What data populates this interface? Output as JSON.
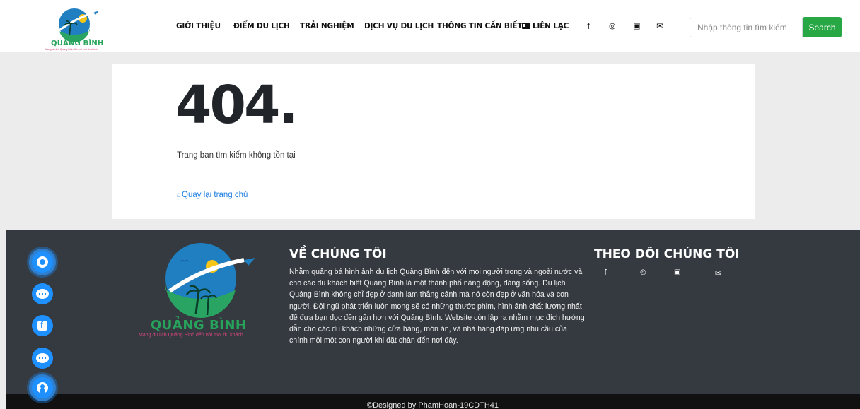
{
  "header": {
    "logo_text": "QUẢNG BÌNH",
    "logo_tagline": "Mang du lịch Quảng Bình đến với mọi du khách",
    "nav": [
      {
        "label": "GIỚI THIỆU"
      },
      {
        "label": "ĐIỂM DU LỊCH"
      },
      {
        "label": "TRẢI NGHIỆM"
      },
      {
        "label": "DỊCH VỤ DU LỊCH"
      },
      {
        "label": "THÔNG TIN CẦN BIẾT"
      },
      {
        "label": "LIÊN LẠC",
        "icon": "id-card-icon"
      }
    ],
    "social_icons": [
      "facebook-icon",
      "instagram-icon",
      "youtube-icon",
      "envelope-icon"
    ],
    "search": {
      "placeholder": "Nhập thông tin tìm kiếm",
      "button_label": "Search"
    }
  },
  "error": {
    "code": "404.",
    "message": "Trang bạn tìm kiếm không tồn tại",
    "home_link": "Quay lại trang chủ",
    "home_icon": "home-icon"
  },
  "footer": {
    "logo_text": "QUẢNG BÌNH",
    "logo_tagline": "Mang du lịch Quảng Bình đến với mọi du khách",
    "about_title": "VỀ CHÚNG TÔI",
    "about_text": "Nhằm quảng bá hình ảnh du lịch Quảng Bình đến với mọi người trong và ngoài nước và cho các du khách biết Quảng Bình là một thành phố năng động, đáng sống. Du lịch Quảng Bình không chỉ đẹp ở danh lam thắng cảnh mà nó còn đẹp ở văn hóa và con người. Đội ngũ phát triển luôn mong sẽ có những thước phim, hình ảnh chất lượng nhất để đưa bạn đọc đến gần hơn với Quảng Bình. Website còn lập ra nhằm mục đích hướng dẫn cho các du khách những cửa hàng, món ăn, và nhà hàng đáp ứng nhu cầu của chính mỗi một con người khi đặt chân đến nơi đây.",
    "follow_title": "THEO DÕI CHÚNG TÔI",
    "social_icons": [
      "facebook-icon",
      "instagram-icon",
      "youtube-icon",
      "envelope-icon"
    ],
    "copyright": "©Designed by PhamHoan-19CDTH41"
  },
  "floating_buttons": [
    "whatsapp-icon",
    "wechat-icon",
    "facebook-messenger-icon",
    "chat-icon",
    "user-icon"
  ],
  "colors": {
    "accent_green": "#28a745",
    "link_blue": "#1e7fe3",
    "footer_bg": "#343a40",
    "fab_blue": "#1e90ff"
  }
}
